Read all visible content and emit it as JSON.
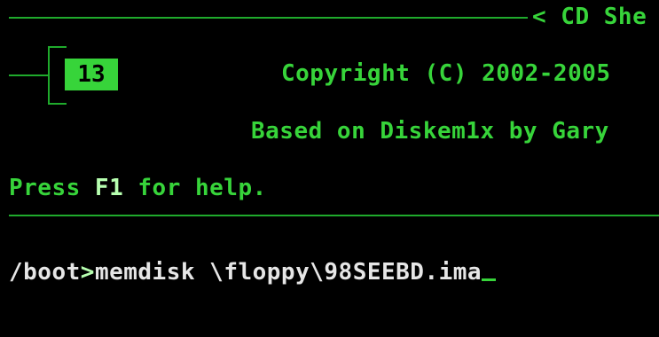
{
  "header": {
    "title": "< CD She"
  },
  "counter": {
    "value": "13"
  },
  "info": {
    "copyright": "Copyright (C) 2002-2005",
    "based_on": "Based on Diskem1x by Gary"
  },
  "help": {
    "prefix": "Press ",
    "key": "F1",
    "suffix": " for help."
  },
  "prompt": {
    "path": "/boot",
    "symbol": ">",
    "command": "memdisk \\floppy\\98SEEBD.ima"
  },
  "colors": {
    "background": "#000000",
    "text_green": "#37d43a",
    "highlight_green": "#b7ffb0",
    "line_green": "#1faa2c",
    "text_white": "#e6e6e6"
  }
}
